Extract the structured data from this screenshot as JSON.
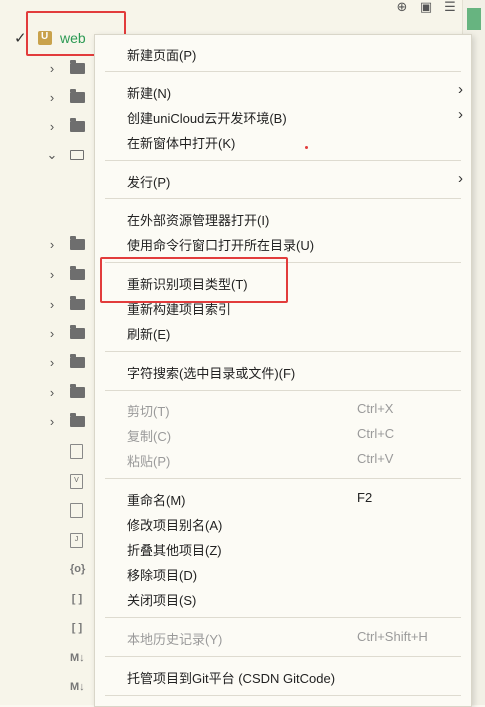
{
  "tree": {
    "root_label": "web",
    "folders": [
      {
        "expanded": false,
        "open": false
      },
      {
        "expanded": false,
        "open": false
      },
      {
        "expanded": false,
        "open": false
      },
      {
        "expanded": true,
        "open": true
      }
    ],
    "lower_folders": [
      {
        "expanded": false
      },
      {
        "expanded": false
      },
      {
        "expanded": false
      },
      {
        "expanded": false
      },
      {
        "expanded": false
      },
      {
        "expanded": false
      },
      {
        "expanded": false
      }
    ],
    "files": [
      {
        "icon": "file-icon",
        "glyph": ""
      },
      {
        "icon": "vue-file-icon",
        "glyph": "V"
      },
      {
        "icon": "file-icon",
        "glyph": ""
      },
      {
        "icon": "js-file-icon",
        "glyph": "J"
      },
      {
        "icon": "json-file-icon",
        "glyph": "{o}"
      },
      {
        "icon": "json-file-icon",
        "glyph": "[ ]"
      },
      {
        "icon": "json-file-icon",
        "glyph": "[ ]"
      },
      {
        "icon": "markdown-file-icon",
        "glyph": "M↓"
      },
      {
        "icon": "markdown-file-icon",
        "glyph": "M↓"
      }
    ]
  },
  "menu": {
    "new_page": "新建页面(P)",
    "new": "新建(N)",
    "create_unicloud": "创建uniCloud云开发环境(B)",
    "open_new_window": "在新窗体中打开(K)",
    "publish": "发行(P)",
    "open_external": "在外部资源管理器打开(I)",
    "open_terminal": "使用命令行窗口打开所在目录(U)",
    "reidentify_type": "重新识别项目类型(T)",
    "rebuild_index": "重新构建项目索引",
    "refresh": "刷新(E)",
    "char_search": "字符搜索(选中目录或文件)(F)",
    "cut": "剪切(T)",
    "cut_shortcut": "Ctrl+X",
    "copy": "复制(C)",
    "copy_shortcut": "Ctrl+C",
    "paste": "粘贴(P)",
    "paste_shortcut": "Ctrl+V",
    "rename": "重命名(M)",
    "rename_shortcut": "F2",
    "edit_alias": "修改项目别名(A)",
    "collapse_others": "折叠其他项目(Z)",
    "remove_project": "移除项目(D)",
    "close_project": "关闭项目(S)",
    "local_history": "本地历史记录(Y)",
    "local_history_shortcut": "Ctrl+Shift+H",
    "host_git": "托管项目到Git平台 (CSDN GitCode)"
  },
  "colors": {
    "annotation_red": "#e23c3c",
    "root_green": "#2c9a54"
  }
}
